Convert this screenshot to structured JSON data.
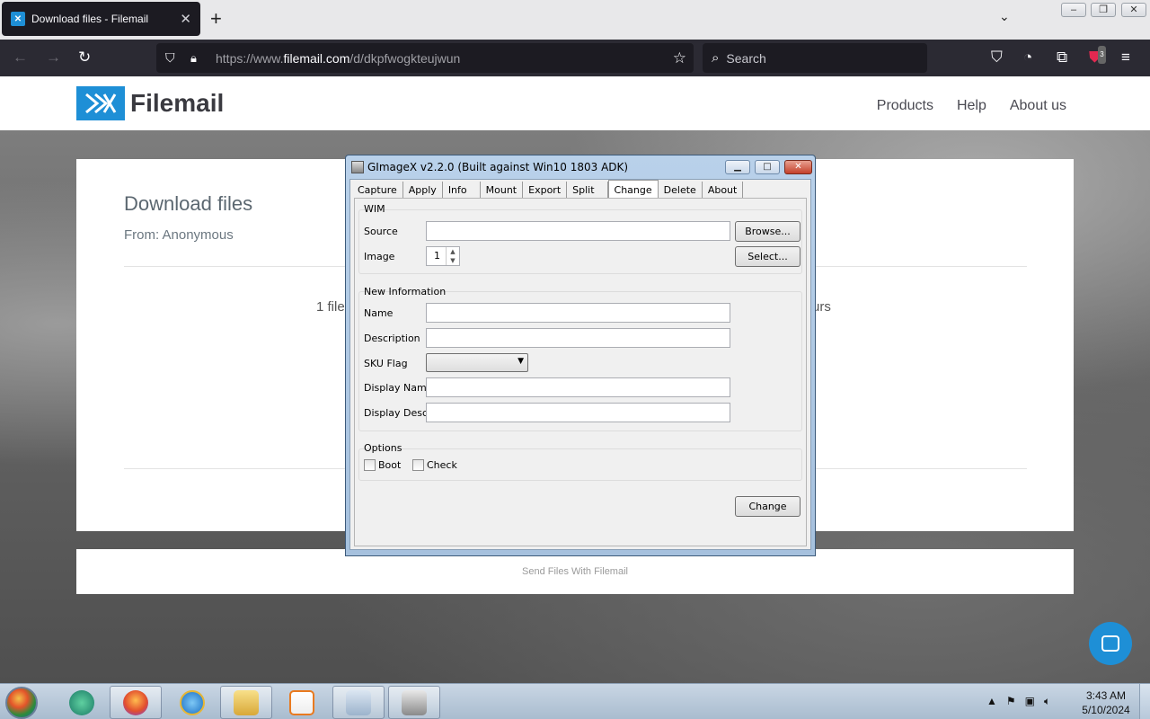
{
  "browser": {
    "tab_title": "Download files - Filemail",
    "tab_close": "✕",
    "new_tab": "+",
    "url_prefix": "https://www.",
    "url_domain": "filemail.com",
    "url_path": "/d/dkpfwogkteujwun",
    "search_placeholder": "Search",
    "extension_badge": "3"
  },
  "site": {
    "logo_text": "Filemail",
    "nav": [
      "Products",
      "Help",
      "About us"
    ],
    "page_title": "Download files",
    "from": "From: Anonymous",
    "files_left": "1 file",
    "files_right": "urs",
    "footer": "Send Files With Filemail",
    "brand_color": "#1e8fd6"
  },
  "dialog": {
    "title": "GImageX v2.2.0 (Built against Win10 1803 ADK)",
    "tabs": [
      "Capture",
      "Apply",
      "Info",
      "Mount",
      "Export",
      "Split",
      "Change",
      "Delete",
      "About"
    ],
    "active_tab": "Change",
    "wim_group": "WIM",
    "source_label": "Source",
    "source_value": "",
    "browse_button": "Browse...",
    "image_label": "Image",
    "image_value": "1",
    "select_button": "Select...",
    "new_info_group": "New Information",
    "name_label": "Name",
    "description_label": "Description",
    "sku_flag_label": "SKU Flag",
    "sku_flag_value": "",
    "display_name_label": "Display Name",
    "display_desc_label": "Display Desc.",
    "options_group": "Options",
    "boot_label": "Boot",
    "check_label": "Check",
    "change_button": "Change"
  },
  "taskbar": {
    "clock_time": "3:43 AM",
    "clock_date": "5/10/2024",
    "apps": [
      "start-menu",
      "browser-edge",
      "firefox",
      "internet-explorer",
      "file-explorer",
      "media-player",
      "control-panel",
      "gimagex"
    ]
  }
}
